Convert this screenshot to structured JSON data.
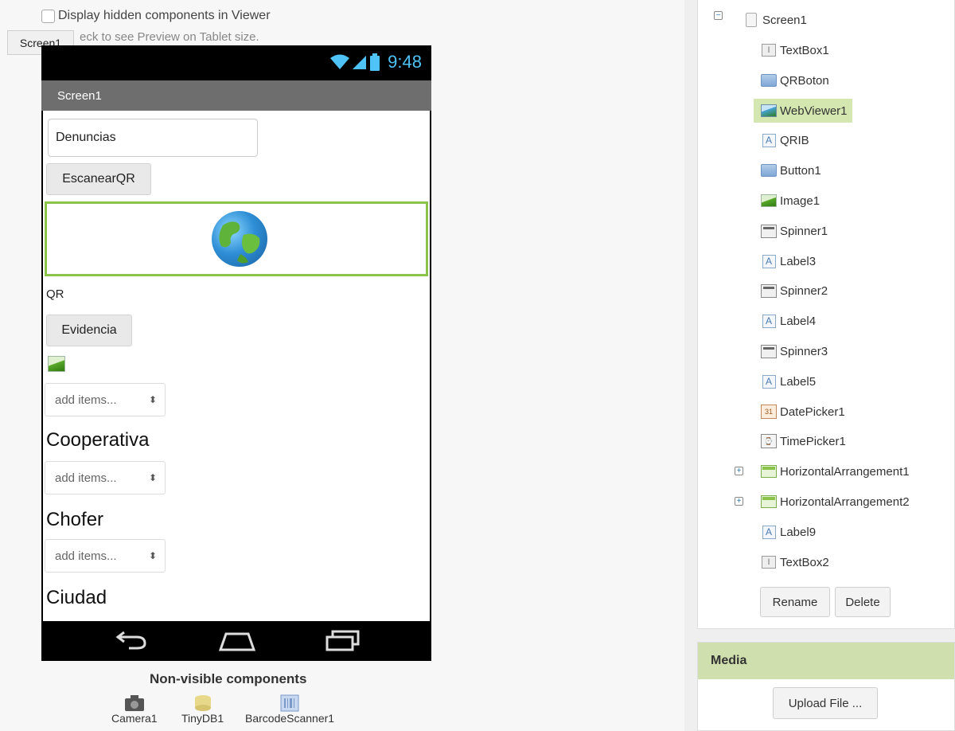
{
  "viewer": {
    "hidden_components_label": "Display hidden components in Viewer",
    "tablet_preview_label": "eck to see Preview on Tablet size.",
    "screen_tab": "Screen1",
    "status_time": "9:48",
    "screen_title": "Screen1",
    "textbox_value": "Denuncias",
    "escanear_button": "EscanearQR",
    "qr_label": "QR",
    "evidencia_button": "Evidencia",
    "spinner_placeholder": "add items...",
    "label_cooperativa": "Cooperativa",
    "label_chofer": "Chofer",
    "label_ciudad": "Ciudad",
    "nonvisible_title": "Non-visible components",
    "nonvisible_items": [
      "Camera1",
      "TinyDB1",
      "BarcodeScanner1"
    ]
  },
  "components": {
    "root": "Screen1",
    "items": [
      {
        "label": "TextBox1",
        "icon": "textbox-icon"
      },
      {
        "label": "QRBoton",
        "icon": "button-icon"
      },
      {
        "label": "WebViewer1",
        "icon": "webviewer-icon",
        "selected": true
      },
      {
        "label": "QRIB",
        "icon": "label-icon"
      },
      {
        "label": "Button1",
        "icon": "button-icon"
      },
      {
        "label": "Image1",
        "icon": "image-icon"
      },
      {
        "label": "Spinner1",
        "icon": "spinner-icon"
      },
      {
        "label": "Label3",
        "icon": "label-icon"
      },
      {
        "label": "Spinner2",
        "icon": "spinner-icon"
      },
      {
        "label": "Label4",
        "icon": "label-icon"
      },
      {
        "label": "Spinner3",
        "icon": "spinner-icon"
      },
      {
        "label": "Label5",
        "icon": "label-icon"
      },
      {
        "label": "DatePicker1",
        "icon": "datepicker-icon"
      },
      {
        "label": "TimePicker1",
        "icon": "timepicker-icon"
      },
      {
        "label": "HorizontalArrangement1",
        "icon": "horizontal-arrangement-icon",
        "expandable": true
      },
      {
        "label": "HorizontalArrangement2",
        "icon": "horizontal-arrangement-icon",
        "expandable": true
      },
      {
        "label": "Label9",
        "icon": "label-icon"
      },
      {
        "label": "TextBox2",
        "icon": "textbox-icon"
      }
    ],
    "rename_button": "Rename",
    "delete_button": "Delete"
  },
  "media": {
    "title": "Media",
    "upload_button": "Upload File ..."
  },
  "colors": {
    "selection": "#d4e7b0",
    "accent_green": "#8bc34a",
    "status_blue": "#4fc3f7"
  }
}
